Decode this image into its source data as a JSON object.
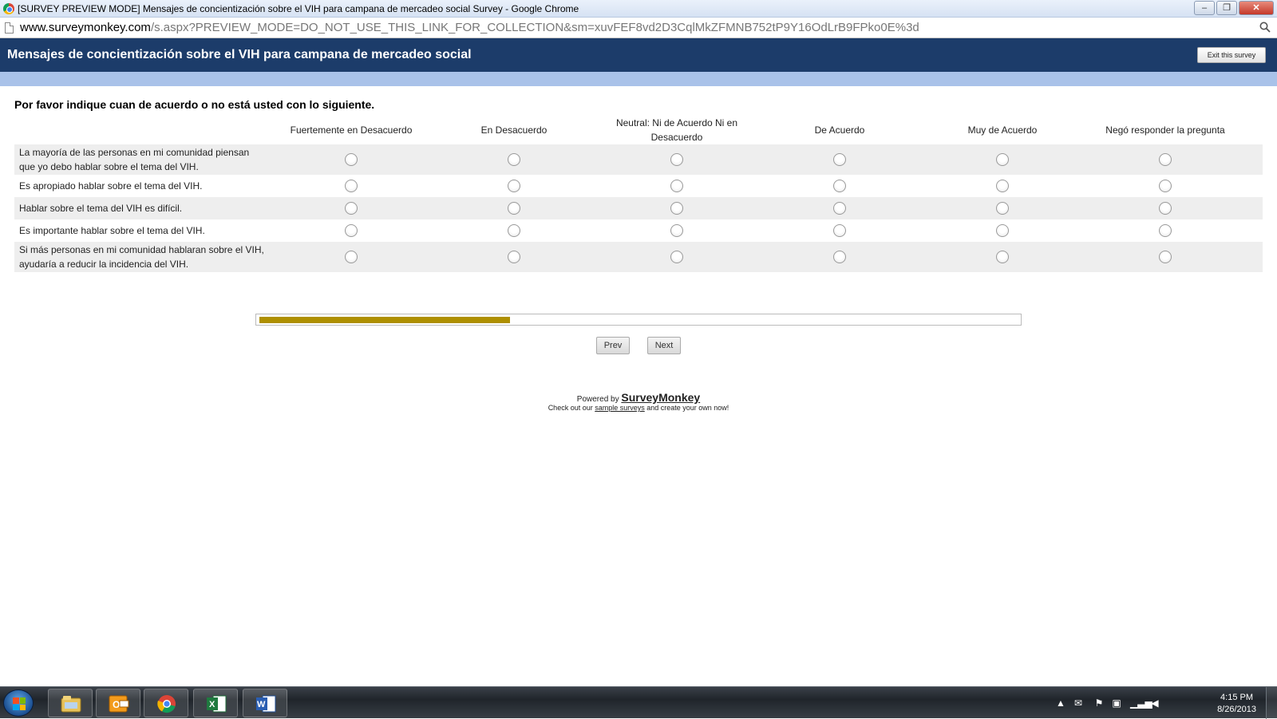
{
  "browser": {
    "window_title": "[SURVEY PREVIEW MODE] Mensajes de concientización sobre el VIH para campana de mercadeo social Survey - Google Chrome",
    "url_host": "www.surveymonkey.com",
    "url_path": "/s.aspx?PREVIEW_MODE=DO_NOT_USE_THIS_LINK_FOR_COLLECTION&sm=xuvFEF8vd2D3CqlMkZFMNB752tP9Y16OdLrB9FPko0E%3d",
    "minimize_label": "–",
    "maximize_label": "❐",
    "close_label": "✕"
  },
  "header": {
    "survey_title": "Mensajes de concientización sobre el VIH para campana de mercadeo social",
    "exit_label": "Exit this survey",
    "colors": {
      "bar": "#1c3c6a",
      "strip": "#a9c2e9"
    }
  },
  "question": {
    "text": "Por favor indique cuan de acuerdo o no está usted con lo siguiente.",
    "columns": [
      "Fuertemente en Desacuerdo",
      "En Desacuerdo",
      "Neutral: Ni de Acuerdo Ni en Desacuerdo",
      "De Acuerdo",
      "Muy de Acuerdo",
      "Negó responder la pregunta"
    ],
    "rows": [
      "La mayoría de las personas en mi comunidad piensan que yo debo hablar sobre el tema del VIH.",
      "Es apropiado hablar sobre el tema del VIH.",
      "Hablar sobre el tema del VIH es difícil.",
      "Es importante hablar sobre el tema del VIH.",
      "Si más personas en mi comunidad hablaran sobre el VIH, ayudaría a reducir la incidencia del VIH."
    ]
  },
  "progress": {
    "fraction": 0.33,
    "color": "#ae8f00"
  },
  "navigation": {
    "prev_label": "Prev",
    "next_label": "Next"
  },
  "footer": {
    "powered_prefix": "Powered by ",
    "brand": "SurveyMonkey",
    "checkout_prefix": "Check out our ",
    "checkout_link": "sample surveys",
    "checkout_suffix": " and create your own now!"
  },
  "taskbar": {
    "apps": [
      "windows-explorer-icon",
      "outlook-icon",
      "chrome-icon",
      "excel-icon",
      "word-icon"
    ],
    "time": "4:15 PM",
    "date": "8/26/2013"
  }
}
